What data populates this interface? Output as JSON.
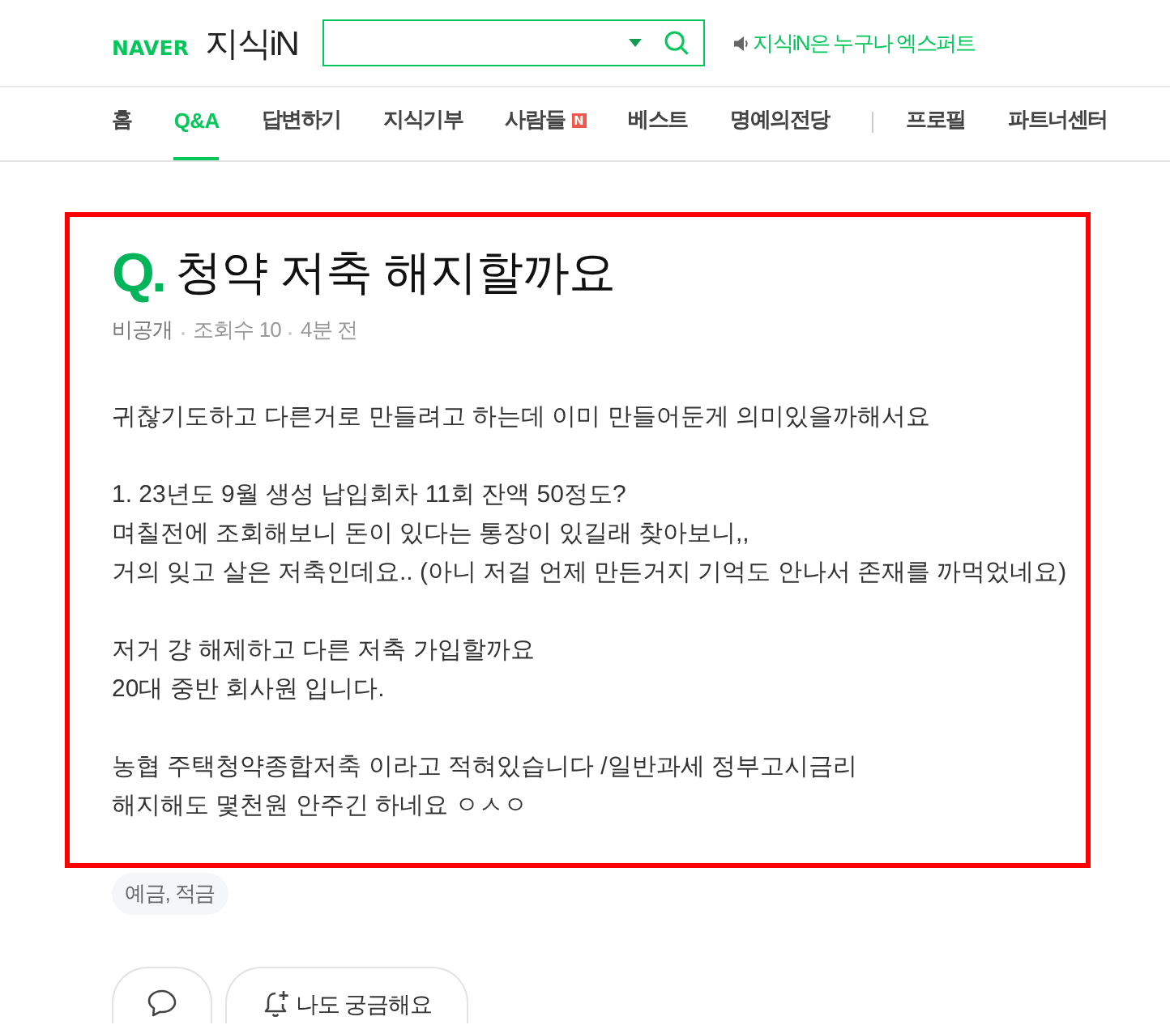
{
  "header": {
    "logo": {
      "brand": "NAVER",
      "service": "지식iN"
    },
    "search": {
      "dropdown": true
    },
    "notice": "지식iN은 누구나 엑스퍼트"
  },
  "nav": {
    "groups": [
      {
        "tabs": [
          {
            "label": "홈",
            "selected": false
          },
          {
            "label": "Q&A",
            "selected": true
          },
          {
            "label": "답변하기",
            "selected": false
          },
          {
            "label": "지식기부",
            "selected": false
          },
          {
            "label": "사람들",
            "selected": false,
            "badge": "N"
          },
          {
            "label": "베스트",
            "selected": false
          },
          {
            "label": "명예의전당",
            "selected": false
          }
        ]
      },
      {
        "tabs": [
          {
            "label": "프로필",
            "selected": false
          },
          {
            "label": "파트너센터",
            "selected": false
          }
        ]
      }
    ]
  },
  "question": {
    "highlighted": true,
    "marker": "Q.",
    "title": "청약 저축 해지할까요",
    "meta": [
      "비공개",
      "조회수 10",
      "4분 전"
    ],
    "body": [
      [
        "귀찮기도하고 다른거로 만들려고 하는데 이미 만들어둔게 의미있을까해서요"
      ],
      [
        "1. 23년도 9월 생성 납입회차 11회 잔액 50정도?",
        "며칠전에 조회해보니 돈이 있다는 통장이 있길래 찾아보니,,",
        "거의 잊고 살은 저축인데요.. (아니 저걸 언제 만든거지 기억도 안나서 존재를 까먹었네요)"
      ],
      [
        "저거 걍 해제하고 다른 저축 가입할까요",
        "20대 중반 회사원 입니다."
      ],
      [
        "농협 주택청약종합저축 이라고 적혀있습니다 /일반과세 정부고시금리",
        "해지해도 몇천원 안주긴 하네요 ㅇㅅㅇ"
      ]
    ]
  },
  "tags": [
    "예금, 적금"
  ],
  "actions": [
    {
      "kind": "comment"
    },
    {
      "kind": "curious",
      "label": "나도 궁금해요"
    }
  ]
}
